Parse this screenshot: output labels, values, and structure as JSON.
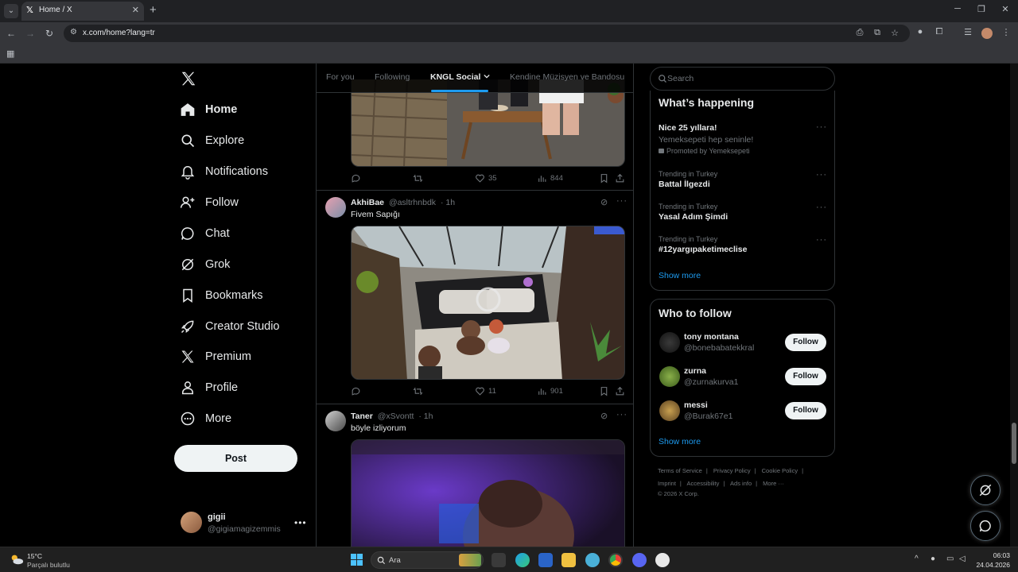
{
  "browser": {
    "tab_title": "Home / X",
    "url": "x.com/home?lang=tr"
  },
  "nav": {
    "items": [
      {
        "label": "Home",
        "icon": "home-icon"
      },
      {
        "label": "Explore",
        "icon": "search-icon"
      },
      {
        "label": "Notifications",
        "icon": "bell-icon"
      },
      {
        "label": "Follow",
        "icon": "person-add-icon"
      },
      {
        "label": "Chat",
        "icon": "chat-icon"
      },
      {
        "label": "Grok",
        "icon": "grok-icon"
      },
      {
        "label": "Bookmarks",
        "icon": "bookmark-icon"
      },
      {
        "label": "Creator Studio",
        "icon": "rocket-icon"
      },
      {
        "label": "Premium",
        "icon": "x-logo-icon"
      },
      {
        "label": "Profile",
        "icon": "person-icon"
      },
      {
        "label": "More",
        "icon": "more-circle-icon"
      }
    ],
    "post_label": "Post",
    "account": {
      "name": "gigii",
      "handle": "@gigiamagizemmis"
    }
  },
  "feed": {
    "tabs": [
      "For you",
      "Following",
      "KNGL Social",
      "Kendine Müzisyen ve Bandosu"
    ],
    "first_post_actions": {
      "likes": "35",
      "views": "844"
    },
    "posts": [
      {
        "name": "AkhiBae",
        "handle": "@asltrhnbdk",
        "time": "· 1h",
        "text": "Fivem Sapığı",
        "likes": "11",
        "views": "901"
      },
      {
        "name": "Taner",
        "handle": "@xSvontt",
        "time": "· 1h",
        "text": "böyle izliyorum"
      }
    ]
  },
  "sidebar": {
    "search_placeholder": "Search",
    "whats_happening": {
      "title": "What’s happening",
      "promo": {
        "title": "Nice 25 yıllara!",
        "subtitle": "Yemeksepeti hep seninle!",
        "promoted": "Promoted by Yemeksepeti"
      },
      "trends": [
        {
          "context": "Trending in Turkey",
          "topic": "Battal İlgezdi"
        },
        {
          "context": "Trending in Turkey",
          "topic": "Yasal Adım Şimdi"
        },
        {
          "context": "Trending in Turkey",
          "topic": "#12yargıpaketimeclise"
        }
      ],
      "show_more": "Show more"
    },
    "who_to_follow": {
      "title": "Who to follow",
      "users": [
        {
          "name": "tony montana",
          "handle": "@bonebabatekkral"
        },
        {
          "name": "zurna",
          "handle": "@zurnakurva1"
        },
        {
          "name": "messi",
          "handle": "@Burak67e1"
        }
      ],
      "follow_label": "Follow",
      "show_more": "Show more"
    },
    "footer": {
      "row1": [
        "Terms of Service",
        "Privacy Policy",
        "Cookie Policy"
      ],
      "row2": [
        "Imprint",
        "Accessibility",
        "Ads info",
        "More ···"
      ],
      "copyright": "© 2026 X Corp."
    }
  },
  "taskbar": {
    "weather_temp": "15°C",
    "weather_desc": "Parçalı bulutlu",
    "search_label": "Ara",
    "time": "06:03",
    "date": "24.04.2026"
  },
  "colors": {
    "accent": "#1d9bf0",
    "background": "#000000",
    "border": "#2f3336",
    "muted_text": "#71767b"
  }
}
